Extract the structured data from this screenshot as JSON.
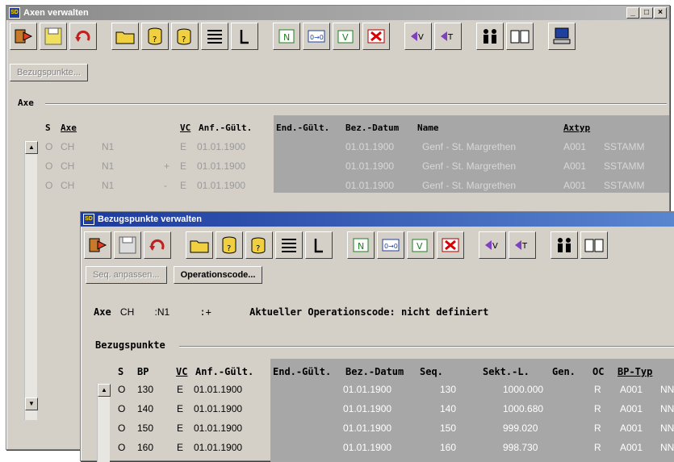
{
  "axen_window": {
    "title": "Axen verwalten",
    "win_buttons": [
      "_",
      "□",
      "×"
    ],
    "button_bezugspunkte": "Bezugspunkte...",
    "group_label": "Axe",
    "headers": [
      "S",
      "Axe",
      "VC",
      "Anf.-Gült.",
      "End.-Gült.",
      "Bez.-Datum",
      "Name",
      "Axtyp"
    ],
    "rows": [
      {
        "s": "O",
        "axe": "CH",
        "n": "N1",
        "sign": "",
        "vc": "E",
        "anf": "01.01.1900",
        "bez": "01.01.1900",
        "name": "Genf - St. Margrethen",
        "axtyp": "A001",
        "extra": "SSTAMM"
      },
      {
        "s": "O",
        "axe": "CH",
        "n": "N1",
        "sign": "+",
        "vc": "E",
        "anf": "01.01.1900",
        "bez": "01.01.1900",
        "name": "Genf - St. Margrethen",
        "axtyp": "A001",
        "extra": "SSTAMM"
      },
      {
        "s": "O",
        "axe": "CH",
        "n": "N1",
        "sign": "-",
        "vc": "E",
        "anf": "01.01.1900",
        "bez": "01.01.1900",
        "name": "Genf - St. Margrethen",
        "axtyp": "A001",
        "extra": "SSTAMM"
      }
    ]
  },
  "bezugspunkte_window": {
    "title": "Bezugspunkte verwalten",
    "button_seq": "Seq. anpassen...",
    "button_opcode": "Operationscode...",
    "info": {
      "axe_label": "Axe",
      "axe_value": "CH",
      "n_value": ":N1",
      "sign_value": ":+",
      "opcode_text": "Aktueller Operationscode: nicht definiert"
    },
    "group_label": "Bezugspunkte",
    "headers": [
      "S",
      "BP",
      "VC",
      "Anf.-Gült.",
      "End.-Gült.",
      "Bez.-Datum",
      "Seq.",
      "Sekt.-L.",
      "Gen.",
      "OC",
      "BP-Typ"
    ],
    "rows": [
      {
        "s": "O",
        "bp": "130",
        "vc": "E",
        "anf": "01.01.1900",
        "bez": "01.01.1900",
        "seq": "130",
        "sekt": "1000.000",
        "oc": "R",
        "typ": "A001",
        "extra": "NN"
      },
      {
        "s": "O",
        "bp": "140",
        "vc": "E",
        "anf": "01.01.1900",
        "bez": "01.01.1900",
        "seq": "140",
        "sekt": "1000.680",
        "oc": "R",
        "typ": "A001",
        "extra": "NN"
      },
      {
        "s": "O",
        "bp": "150",
        "vc": "E",
        "anf": "01.01.1900",
        "bez": "01.01.1900",
        "seq": "150",
        "sekt": "999.020",
        "oc": "R",
        "typ": "A001",
        "extra": "NN"
      },
      {
        "s": "O",
        "bp": "160",
        "vc": "E",
        "anf": "01.01.1900",
        "bez": "01.01.1900",
        "seq": "160",
        "sekt": "998.730",
        "oc": "R",
        "typ": "A001",
        "extra": "NN"
      }
    ]
  },
  "toolbar_icons": [
    "exit-icon",
    "save-icon",
    "undo-icon",
    "open-folder-icon",
    "query-icon",
    "query-edit-icon",
    "list-icon",
    "l-icon",
    "new-icon",
    "copy-icon",
    "filter-icon",
    "delete-icon",
    "prev-icon",
    "next-icon",
    "users-icon",
    "book-icon",
    "computer-icon"
  ],
  "colors": {
    "title_active": "#1c3a9e",
    "title_inactive": "#8a8a8a",
    "window_bg": "#d4d0c8",
    "dark_column": "#a7a7a7"
  }
}
